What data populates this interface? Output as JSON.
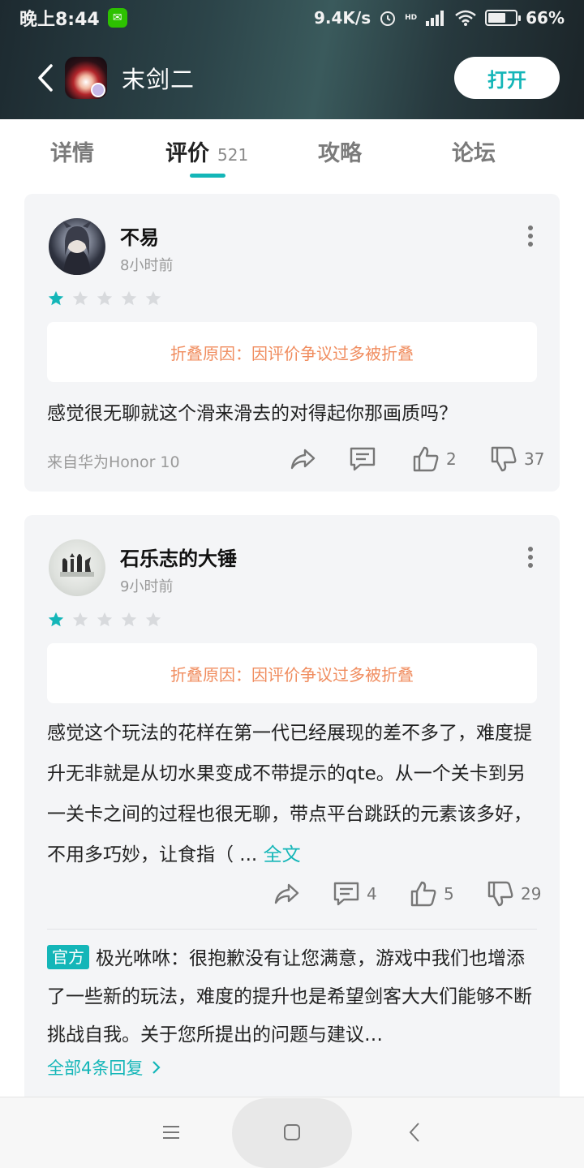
{
  "status_bar": {
    "time": "晚上8:44",
    "net_speed": "9.4K/s",
    "network_type": "HD",
    "battery": "66%",
    "battery_level": 0.66
  },
  "header": {
    "app_title": "末剑二",
    "open_label": "打开"
  },
  "tabs": [
    {
      "label": "详情",
      "count": ""
    },
    {
      "label": "评价",
      "count": "521"
    },
    {
      "label": "攻略",
      "count": ""
    },
    {
      "label": "论坛",
      "count": ""
    }
  ],
  "reviews": [
    {
      "username": "不易",
      "time": "8小时前",
      "rating": 1,
      "max_rating": 5,
      "fold_reason": "折叠原因：因评价争议过多被折叠",
      "text": "感觉很无聊就这个滑来滑去的对得起你那画质吗？",
      "device": "来自华为Honor 10",
      "like_count": "2",
      "dislike_count": "37"
    },
    {
      "username": "石乐志的大锤",
      "time": "9小时前",
      "rating": 1,
      "max_rating": 5,
      "fold_reason": "折叠原因：因评价争议过多被折叠",
      "text": "感觉这个玩法的花样在第一代已经展现的差不多了，难度提升无非就是从切水果变成不带提示的qte。从一个关卡到另一关卡之间的过程也很无聊，带点平台跳跃的元素该多好，不用多巧妙，让食指（ ...",
      "full_text_label": "全文",
      "reply_count": "4",
      "like_count": "5",
      "dislike_count": "29",
      "official_reply": {
        "badge": "官方",
        "author": "极光咻咻",
        "text": "极光咻咻：很抱歉没有让您满意，游戏中我们也增添了一些新的玩法，难度的提升也是希望剑客大大们能够不断挑战自我。关于您所提出的问题与建议…",
        "all_replies_label": "全部4条回复"
      }
    }
  ],
  "colors": {
    "accent": "#14b6b8",
    "fold_text": "#f08c5e",
    "card_bg": "#f4f5f7"
  }
}
